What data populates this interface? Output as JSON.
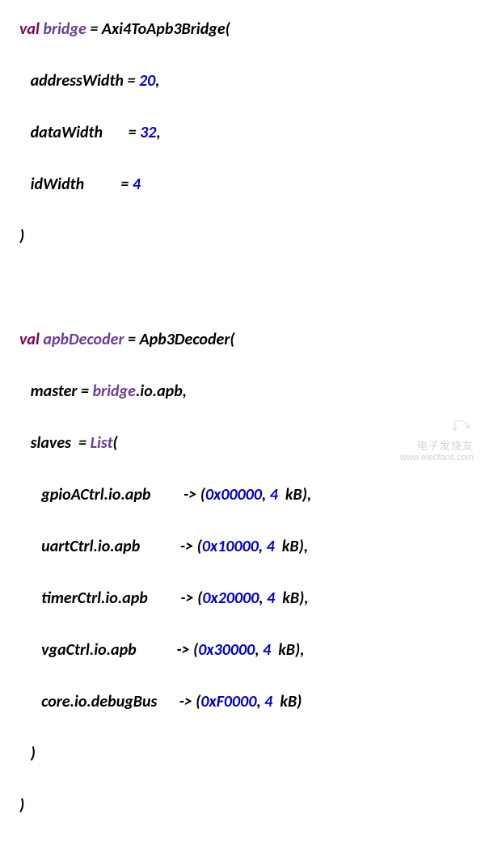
{
  "decl1": {
    "kw": "val",
    "name": "bridge",
    "ctor": "Axi4ToApb3Bridge",
    "params": [
      {
        "label": "addressWidth",
        "value": "20",
        "comma": ","
      },
      {
        "label": "dataWidth",
        "value": "32",
        "comma": ","
      },
      {
        "label": "idWidth",
        "value": "4",
        "comma": ""
      }
    ]
  },
  "decl2": {
    "kw": "val",
    "name": "apbDecoder",
    "ctor": "Apb3Decoder",
    "master_label": "master",
    "master_ref_head": "bridge",
    "master_ref_tail": ".io.apb,",
    "slaves_label": "slaves",
    "list_ctor": "List",
    "rows": [
      {
        "lhs": "gpioACtrl.io.apb",
        "addr": "0x00000",
        "size_n": "4",
        "size_u": "kB",
        "comma": ","
      },
      {
        "lhs": "uartCtrl.io.apb",
        "addr": "0x10000",
        "size_n": "4",
        "size_u": "kB",
        "comma": ","
      },
      {
        "lhs": "timerCtrl.io.apb",
        "addr": "0x20000",
        "size_n": "4",
        "size_u": "kB",
        "comma": ","
      },
      {
        "lhs": "vgaCtrl.io.apb",
        "addr": "0x30000",
        "size_n": "4",
        "size_u": "kB",
        "comma": ","
      },
      {
        "lhs": "core.io.debugBus",
        "addr": "0xF0000",
        "size_n": "4",
        "size_u": "kB",
        "comma": ""
      }
    ]
  },
  "watermark": {
    "brand": "电子发烧友",
    "url": "www.elecfans.com"
  }
}
